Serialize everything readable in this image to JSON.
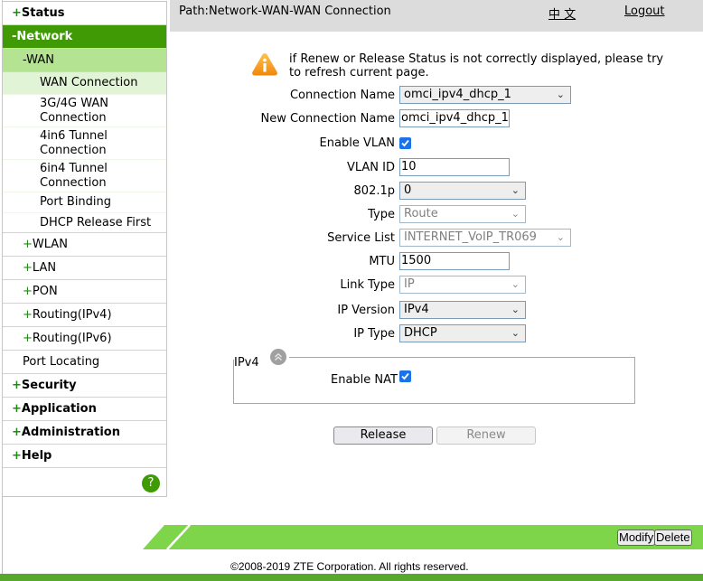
{
  "colors": {
    "menu_active": "#3f9a06",
    "submenu_active": "#b4e391",
    "leaf_active": "#e2f4d6",
    "green_bar": "#7ed54a",
    "bottom_strip": "#57a82c",
    "checkbox": "#1a73e8"
  },
  "header": {
    "path": "Path:Network-WAN-WAN Connection",
    "language_link": "中 文",
    "logout_link": "Logout"
  },
  "sidebar": {
    "items": [
      {
        "prefix": "+",
        "label": "Status"
      },
      {
        "prefix": "-",
        "label": "Network"
      },
      {
        "prefix": "-",
        "label": "WAN"
      },
      {
        "label": "WAN Connection"
      },
      {
        "label": "3G/4G WAN Connection"
      },
      {
        "label": "4in6 Tunnel Connection"
      },
      {
        "label": "6in4 Tunnel Connection"
      },
      {
        "label": "Port Binding"
      },
      {
        "label": "DHCP Release First"
      },
      {
        "prefix": "+",
        "label": "WLAN"
      },
      {
        "prefix": "+",
        "label": "LAN"
      },
      {
        "prefix": "+",
        "label": "PON"
      },
      {
        "prefix": "+",
        "label": "Routing(IPv4)"
      },
      {
        "prefix": "+",
        "label": "Routing(IPv6)"
      },
      {
        "label": "Port Locating"
      },
      {
        "prefix": "+",
        "label": "Security"
      },
      {
        "prefix": "+",
        "label": "Application"
      },
      {
        "prefix": "+",
        "label": "Administration"
      },
      {
        "prefix": "+",
        "label": "Help"
      }
    ],
    "leaf_lines": {
      "g34_1": "3G/4G WAN",
      "g34_2": "Connection",
      "t46_1": "4in6 Tunnel",
      "t46_2": "Connection",
      "t64_1": "6in4 Tunnel",
      "t64_2": "Connection"
    },
    "help_icon": "?"
  },
  "notice": {
    "icon": "warning-icon",
    "text": "if Renew or Release Status is not correctly displayed, please try to refresh current page."
  },
  "form": {
    "connection_name": {
      "label": "Connection Name",
      "value": "omci_ipv4_dhcp_1"
    },
    "new_connection_name": {
      "label": "New Connection Name",
      "value": "omci_ipv4_dhcp_1"
    },
    "enable_vlan": {
      "label": "Enable VLAN",
      "checked": true
    },
    "vlan_id": {
      "label": "VLAN ID",
      "value": "10"
    },
    "dot1p": {
      "label": "802.1p",
      "value": "0"
    },
    "type": {
      "label": "Type",
      "value": "Route",
      "disabled": true
    },
    "service_list": {
      "label": "Service List",
      "value": "INTERNET_VoIP_TR069",
      "disabled": true
    },
    "mtu": {
      "label": "MTU",
      "value": "1500"
    },
    "link_type": {
      "label": "Link Type",
      "value": "IP",
      "disabled": true
    },
    "ip_version": {
      "label": "IP Version",
      "value": "IPv4"
    },
    "ip_type": {
      "label": "IP Type",
      "value": "DHCP"
    },
    "ipv4_section": {
      "legend": "IPv4",
      "enable_nat": {
        "label": "Enable NAT",
        "checked": true
      }
    }
  },
  "actions": {
    "release": "Release",
    "renew": "Renew",
    "modify": "Modify",
    "delete": "Delete"
  },
  "footer": {
    "copyright": "©2008-2019 ZTE Corporation. All rights reserved."
  }
}
